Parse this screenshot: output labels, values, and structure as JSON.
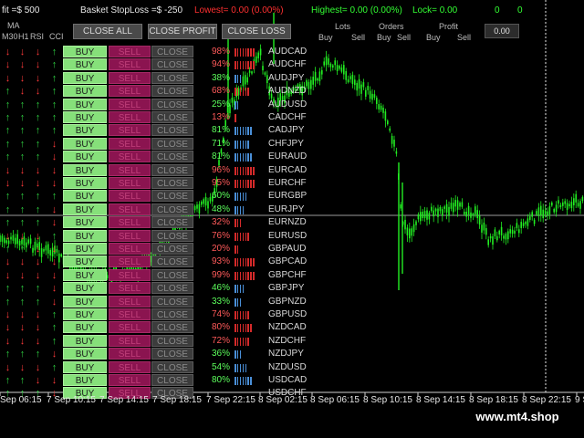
{
  "header": {
    "profit_target": "fit =$ 500",
    "basket_stoploss": "Basket StopLoss =$ -250",
    "lowest": "Lowest= 0.00 (0.00%)",
    "highest": "Highest= 0.00 (0.00%)",
    "lock": "Lock= 0.00",
    "count_a": "0",
    "count_b": "0"
  },
  "column_headers": {
    "ma": "MA",
    "m30": "M30",
    "h1": "H1",
    "rsi": "RSI",
    "cci": "CCI",
    "lots": "Lots",
    "orders": "Orders",
    "profit": "Profit",
    "lots_buy": "Buy",
    "lots_sell": "Sell",
    "orders_buy": "Buy",
    "orders_sell": "Sell",
    "profit_buy": "Buy",
    "profit_sell": "Sell"
  },
  "top_buttons": {
    "close_all": "CLOSE ALL",
    "close_profit": "CLOSE PROFIT",
    "close_loss": "CLOSE LOSS"
  },
  "profit_value": "0.00",
  "row_buttons": {
    "buy": "BUY",
    "sell": "SELL",
    "close": "CLOSE"
  },
  "colors": {
    "up": "#2ecc40",
    "down": "#ff3b3b",
    "bar_red": "#d42a2a",
    "bar_blue": "#4a8fd8",
    "pct_red": "#ff5a5a",
    "pct_green": "#5cff5c",
    "candle": "#22ee22"
  },
  "rows": [
    {
      "symbol": "AUDCAD",
      "pct": "98%",
      "dir": "down",
      "arrows": [
        "dn",
        "dn",
        "dn",
        "up"
      ]
    },
    {
      "symbol": "AUDCHF",
      "pct": "94%",
      "dir": "down",
      "arrows": [
        "dn",
        "dn",
        "dn",
        "up"
      ]
    },
    {
      "symbol": "AUDJPY",
      "pct": "38%",
      "dir": "up",
      "arrows": [
        "dn",
        "dn",
        "dn",
        "up"
      ]
    },
    {
      "symbol": "AUDNZD",
      "pct": "68%",
      "dir": "down",
      "arrows": [
        "up",
        "dn",
        "dn",
        "up"
      ]
    },
    {
      "symbol": "AUDUSD",
      "pct": "25%",
      "dir": "up",
      "arrows": [
        "up",
        "up",
        "up",
        "up"
      ]
    },
    {
      "symbol": "CADCHF",
      "pct": "13%",
      "dir": "down",
      "arrows": [
        "up",
        "up",
        "up",
        "up"
      ]
    },
    {
      "symbol": "CADJPY",
      "pct": "81%",
      "dir": "up",
      "arrows": [
        "up",
        "up",
        "up",
        "up"
      ]
    },
    {
      "symbol": "CHFJPY",
      "pct": "71%",
      "dir": "up",
      "arrows": [
        "up",
        "up",
        "up",
        "dn"
      ]
    },
    {
      "symbol": "EURAUD",
      "pct": "81%",
      "dir": "up",
      "arrows": [
        "up",
        "up",
        "up",
        "dn"
      ]
    },
    {
      "symbol": "EURCAD",
      "pct": "96%",
      "dir": "down",
      "arrows": [
        "dn",
        "dn",
        "dn",
        "dn"
      ]
    },
    {
      "symbol": "EURCHF",
      "pct": "95%",
      "dir": "down",
      "arrows": [
        "dn",
        "dn",
        "dn",
        "dn"
      ]
    },
    {
      "symbol": "EURGBP",
      "pct": "60%",
      "dir": "up",
      "arrows": [
        "up",
        "up",
        "up",
        "up"
      ]
    },
    {
      "symbol": "EURJPY",
      "pct": "48%",
      "dir": "up",
      "arrows": [
        "up",
        "up",
        "up",
        "dn"
      ]
    },
    {
      "symbol": "EURNZD",
      "pct": "32%",
      "dir": "down",
      "arrows": [
        "up",
        "up",
        "up",
        "dn"
      ]
    },
    {
      "symbol": "EURUSD",
      "pct": "76%",
      "dir": "down",
      "arrows": [
        "dn",
        "dn",
        "dn",
        "up"
      ]
    },
    {
      "symbol": "GBPAUD",
      "pct": "20%",
      "dir": "down",
      "arrows": [
        "up",
        "up",
        "dn",
        "dn"
      ]
    },
    {
      "symbol": "GBPCAD",
      "pct": "93%",
      "dir": "down",
      "arrows": [
        "dn",
        "dn",
        "dn",
        "dn"
      ]
    },
    {
      "symbol": "GBPCHF",
      "pct": "99%",
      "dir": "down",
      "arrows": [
        "dn",
        "dn",
        "dn",
        "dn"
      ]
    },
    {
      "symbol": "GBPJPY",
      "pct": "46%",
      "dir": "up",
      "arrows": [
        "up",
        "up",
        "up",
        "dn"
      ]
    },
    {
      "symbol": "GBPNZD",
      "pct": "33%",
      "dir": "up",
      "arrows": [
        "up",
        "up",
        "up",
        "dn"
      ]
    },
    {
      "symbol": "GBPUSD",
      "pct": "74%",
      "dir": "down",
      "arrows": [
        "dn",
        "dn",
        "dn",
        "up"
      ]
    },
    {
      "symbol": "NZDCAD",
      "pct": "80%",
      "dir": "down",
      "arrows": [
        "dn",
        "dn",
        "dn",
        "up"
      ]
    },
    {
      "symbol": "NZDCHF",
      "pct": "72%",
      "dir": "down",
      "arrows": [
        "dn",
        "dn",
        "dn",
        "up"
      ]
    },
    {
      "symbol": "NZDJPY",
      "pct": "36%",
      "dir": "up",
      "arrows": [
        "up",
        "up",
        "up",
        "dn"
      ]
    },
    {
      "symbol": "NZDUSD",
      "pct": "54%",
      "dir": "up",
      "arrows": [
        "dn",
        "dn",
        "dn",
        "up"
      ]
    },
    {
      "symbol": "USDCAD",
      "pct": "80%",
      "dir": "up",
      "arrows": [
        "up",
        "up",
        "dn",
        "dn"
      ]
    },
    {
      "symbol": "USDCHF",
      "pct": "",
      "dir": "up",
      "arrows": [
        "up",
        "up",
        "up",
        "dn"
      ]
    }
  ],
  "time_axis": [
    "Sep 06:15",
    "7 Sep 10:15",
    "7 Sep 14:15",
    "7 Sep 18:15",
    "7 Sep 22:15",
    "8 Sep 02:15",
    "8 Sep 06:15",
    "8 Sep 10:15",
    "8 Sep 14:15",
    "8 Sep 18:15",
    "8 Sep 22:15",
    "9 S"
  ],
  "watermark": "www.mt4.shop"
}
